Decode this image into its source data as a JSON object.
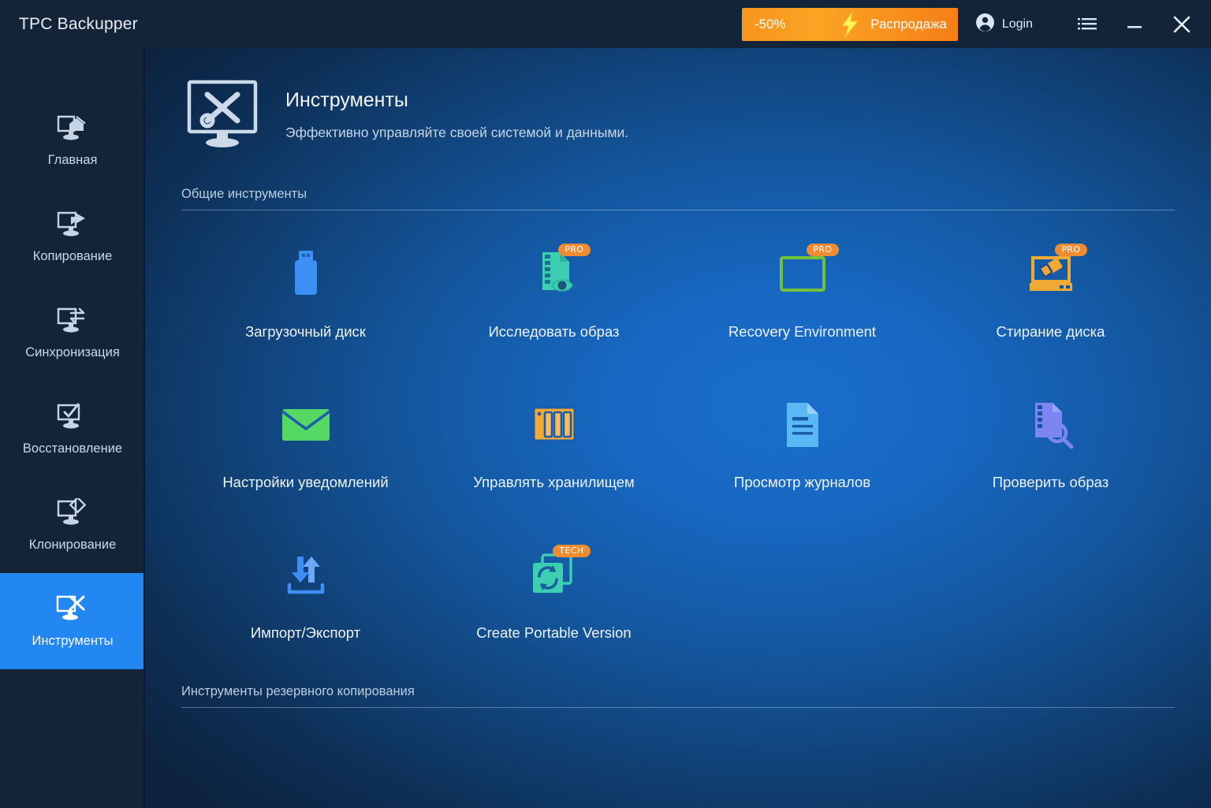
{
  "window": {
    "title": "TPC Backupper",
    "controls": {
      "menu_icon": "list-menu-icon",
      "minimize_icon": "minimize-icon",
      "close_icon": "close-icon"
    }
  },
  "promo": {
    "discount": "-50%",
    "label": "Распродажа",
    "icon": "lightning-bolt-icon",
    "color": "#f7941d"
  },
  "account": {
    "label": "Login",
    "icon": "user-account-icon"
  },
  "sidebar": {
    "active_index": 5,
    "active_color": "#2287f0",
    "items": [
      {
        "label": "Главная",
        "icon": "monitor-home-icon"
      },
      {
        "label": "Копирование",
        "icon": "monitor-backup-arrow-icon"
      },
      {
        "label": "Синхронизация",
        "icon": "monitor-sync-arrows-icon"
      },
      {
        "label": "Восстановление",
        "icon": "monitor-restore-icon"
      },
      {
        "label": "Клонирование",
        "icon": "monitor-clone-icon"
      },
      {
        "label": "Инструменты",
        "icon": "monitor-tools-icon"
      }
    ]
  },
  "page": {
    "icon": "monitor-tools-icon",
    "title": "Инструменты",
    "subtitle": "Эффективно управляйте своей системой и данными."
  },
  "sections": [
    {
      "title": "Общие инструменты",
      "tools": [
        {
          "label": "Загрузочный диск",
          "icon": "usb-flash-drive-icon",
          "badge": null,
          "color": "#3d8ef5"
        },
        {
          "label": "Исследовать образ",
          "icon": "image-explore-eye-icon",
          "badge": "PRO",
          "color": "#3ecfb2"
        },
        {
          "label": "Recovery Environment",
          "icon": "recovery-environment-icon",
          "badge": "PRO",
          "color": "#72c13c"
        },
        {
          "label": "Стирание диска",
          "icon": "disk-wipe-eraser-icon",
          "badge": "PRO",
          "color": "#f0a934"
        },
        {
          "label": "Настройки уведомлений",
          "icon": "email-envelope-icon",
          "badge": null,
          "color": "#56d964"
        },
        {
          "label": "Управлять хранилищем",
          "icon": "nas-storage-icon",
          "badge": null,
          "color": "#f0a934"
        },
        {
          "label": "Просмотр журналов",
          "icon": "document-log-icon",
          "badge": null,
          "color": "#5ab9f5"
        },
        {
          "label": "Проверить образ",
          "icon": "image-check-magnifier-icon",
          "badge": null,
          "color": "#7b86f0"
        },
        {
          "label": "Импорт/Экспорт",
          "icon": "import-export-arrows-icon",
          "badge": null,
          "color": "#3d8ef5"
        },
        {
          "label": "Create Portable Version",
          "icon": "portable-version-sync-icon",
          "badge": "TECH",
          "color": "#3ecfb2"
        }
      ]
    },
    {
      "title": "Инструменты резервного копирования",
      "tools": []
    }
  ],
  "theme": {
    "titlebar_bg": "#132338",
    "sidebar_bg": "#132338",
    "main_bg_center": "#1a6ecb",
    "main_bg_edge": "#0d233f",
    "badge_bg": "#ef8b30"
  }
}
